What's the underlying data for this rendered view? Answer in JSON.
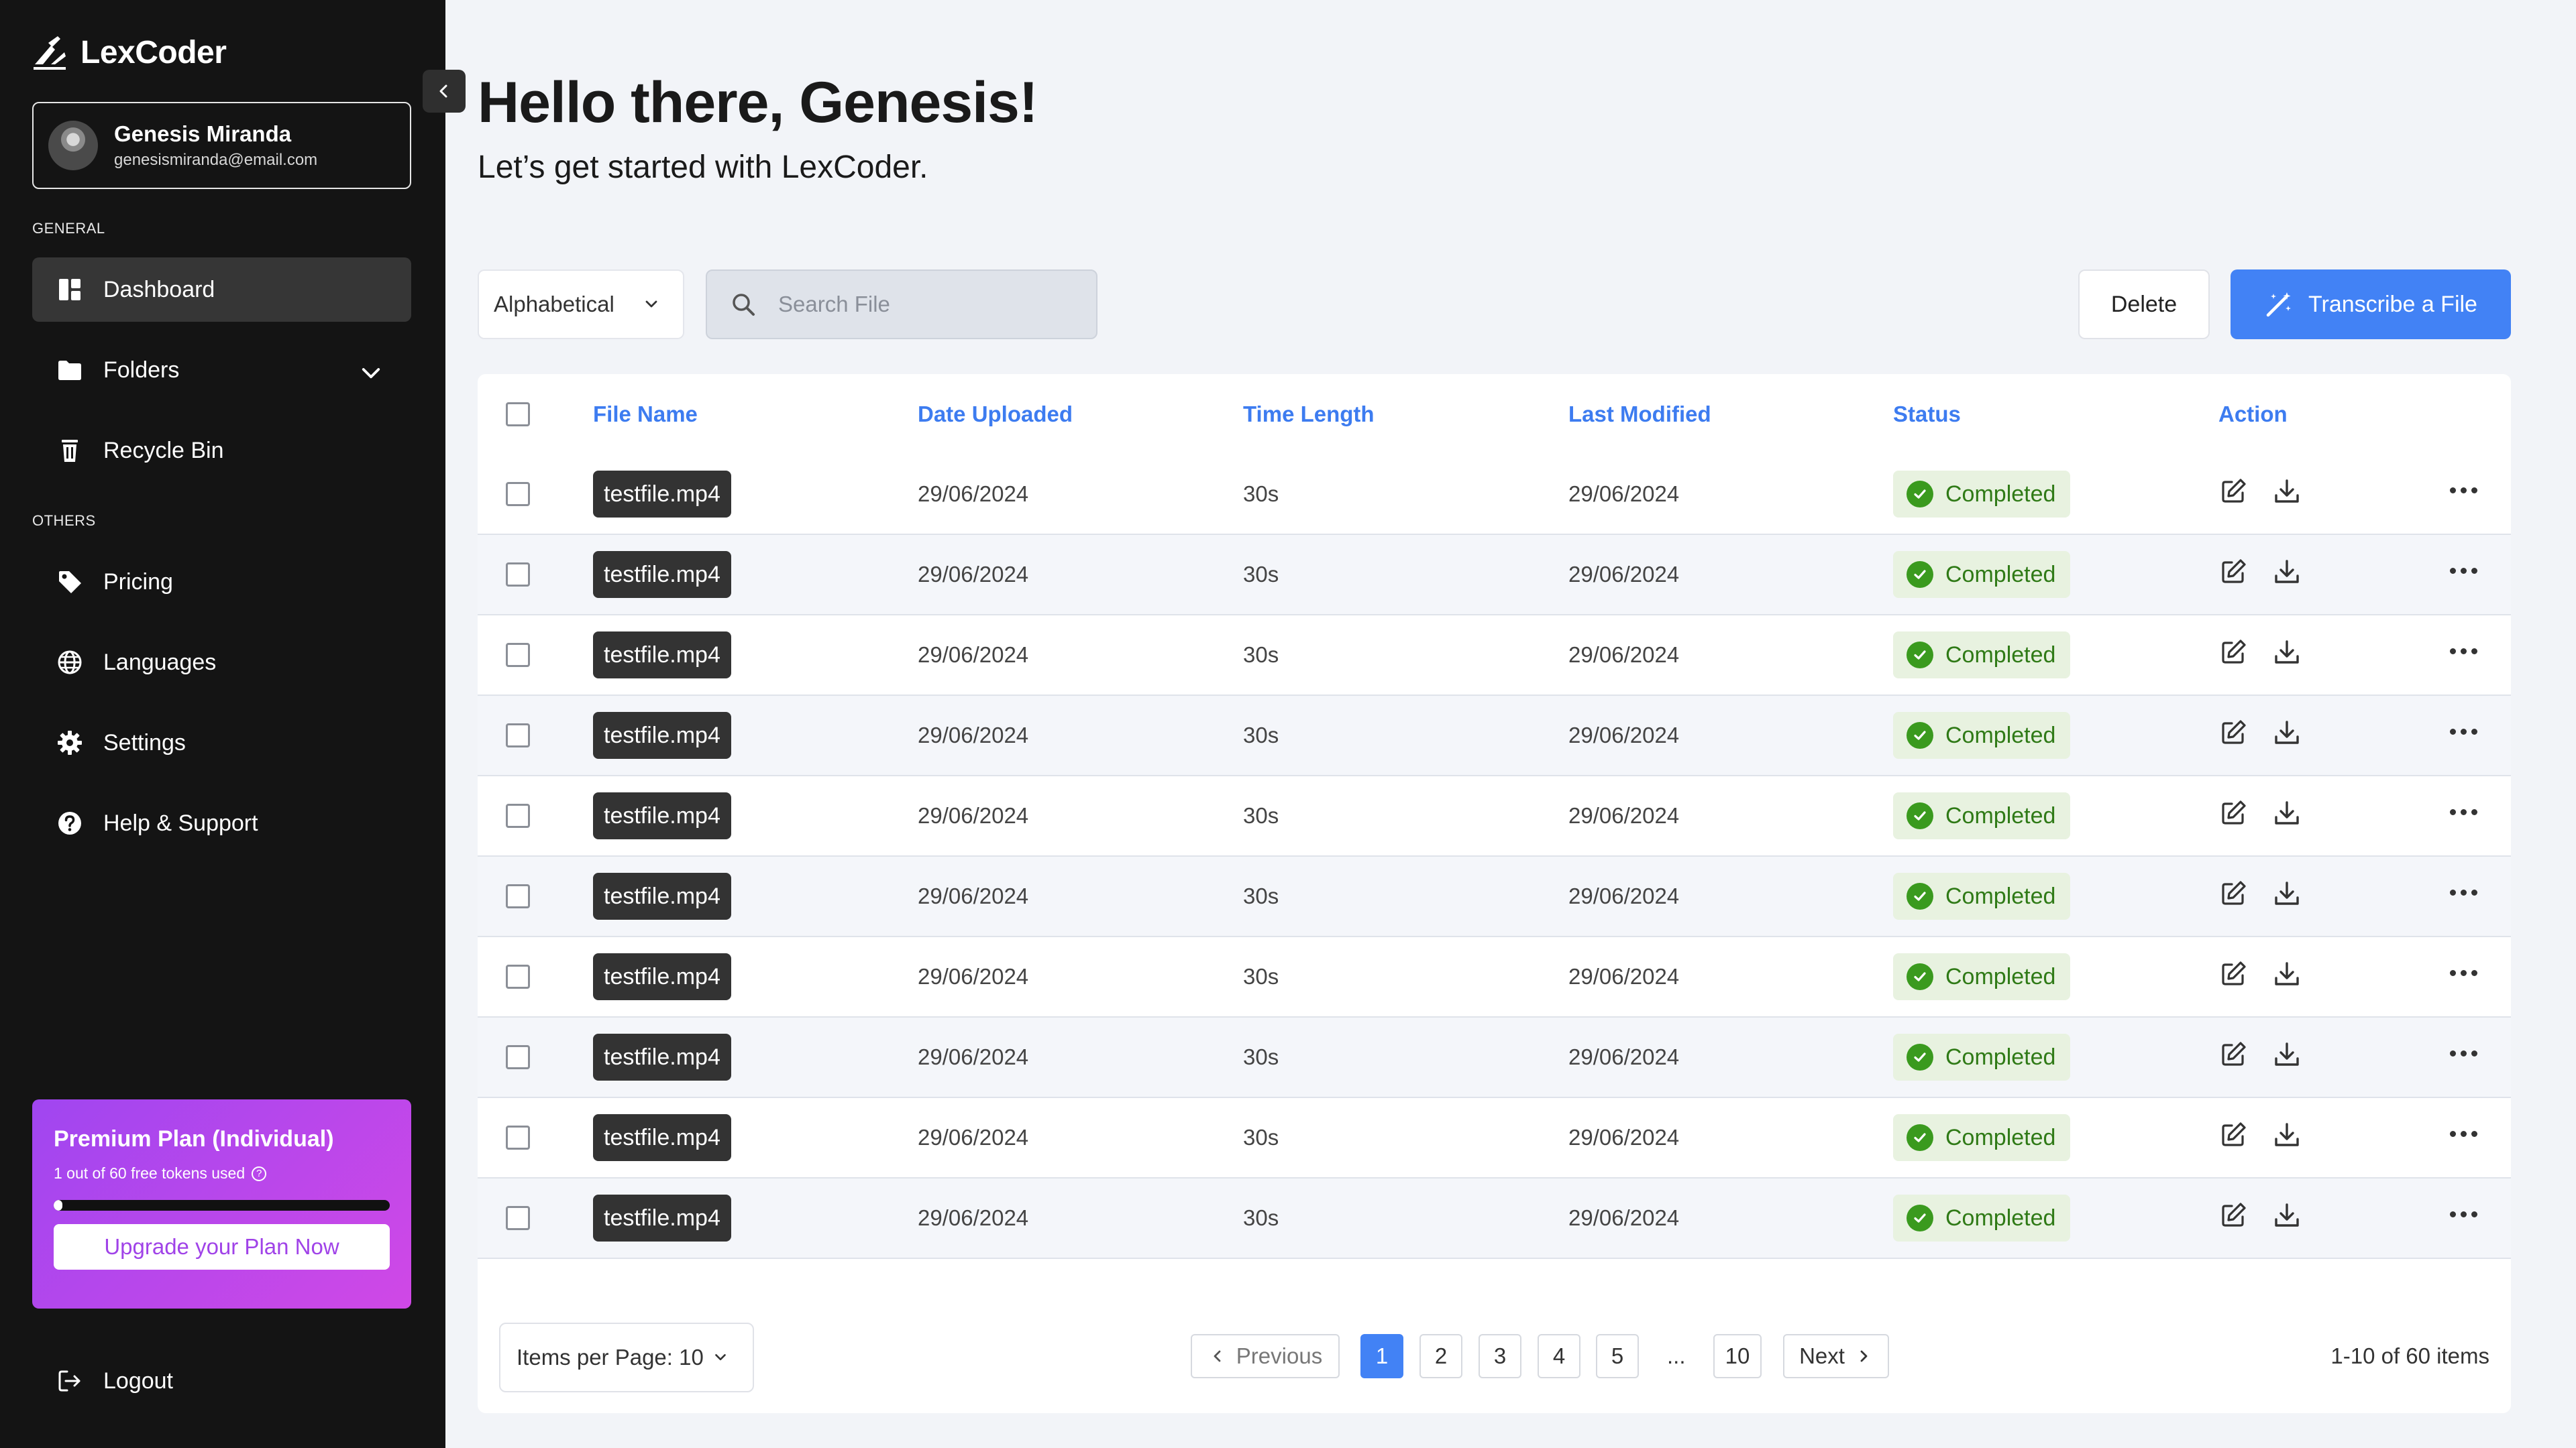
{
  "app": {
    "name": "LexCoder"
  },
  "user": {
    "name": "Genesis Miranda",
    "email": "genesismiranda@email.com"
  },
  "sidebar": {
    "general_label": "GENERAL",
    "others_label": "OTHERS",
    "general_items": [
      {
        "label": "Dashboard",
        "icon": "dashboard-icon",
        "active": true
      },
      {
        "label": "Folders",
        "icon": "folder-icon",
        "expandable": true
      },
      {
        "label": "Recycle Bin",
        "icon": "trash-icon"
      }
    ],
    "other_items": [
      {
        "label": "Pricing",
        "icon": "tag-icon"
      },
      {
        "label": "Languages",
        "icon": "globe-icon"
      },
      {
        "label": "Settings",
        "icon": "gear-icon"
      },
      {
        "label": "Help & Support",
        "icon": "help-icon"
      }
    ],
    "plan": {
      "title": "Premium Plan (Individual)",
      "usage": "1 out of 60 free tokens used",
      "usage_fraction": 0.0167,
      "upgrade_label": "Upgrade your Plan Now",
      "accent": "#a046f0"
    },
    "logout_label": "Logout"
  },
  "header": {
    "greeting": "Hello there, Genesis!",
    "subtitle": "Let’s get started with LexCoder."
  },
  "toolbar": {
    "sort_value": "Alphabetical",
    "search_placeholder": "Search File",
    "delete_label": "Delete",
    "transcribe_label": "Transcribe a File",
    "accent": "#4282f5"
  },
  "table": {
    "columns": [
      "File Name",
      "Date Uploaded",
      "Time Length",
      "Last Modified",
      "Status",
      "Action"
    ],
    "rows": [
      {
        "file": "testfile.mp4",
        "uploaded": "29/06/2024",
        "length": "30s",
        "modified": "29/06/2024",
        "status": "Completed"
      },
      {
        "file": "testfile.mp4",
        "uploaded": "29/06/2024",
        "length": "30s",
        "modified": "29/06/2024",
        "status": "Completed"
      },
      {
        "file": "testfile.mp4",
        "uploaded": "29/06/2024",
        "length": "30s",
        "modified": "29/06/2024",
        "status": "Completed"
      },
      {
        "file": "testfile.mp4",
        "uploaded": "29/06/2024",
        "length": "30s",
        "modified": "29/06/2024",
        "status": "Completed"
      },
      {
        "file": "testfile.mp4",
        "uploaded": "29/06/2024",
        "length": "30s",
        "modified": "29/06/2024",
        "status": "Completed"
      },
      {
        "file": "testfile.mp4",
        "uploaded": "29/06/2024",
        "length": "30s",
        "modified": "29/06/2024",
        "status": "Completed"
      },
      {
        "file": "testfile.mp4",
        "uploaded": "29/06/2024",
        "length": "30s",
        "modified": "29/06/2024",
        "status": "Completed"
      },
      {
        "file": "testfile.mp4",
        "uploaded": "29/06/2024",
        "length": "30s",
        "modified": "29/06/2024",
        "status": "Completed"
      },
      {
        "file": "testfile.mp4",
        "uploaded": "29/06/2024",
        "length": "30s",
        "modified": "29/06/2024",
        "status": "Completed"
      },
      {
        "file": "testfile.mp4",
        "uploaded": "29/06/2024",
        "length": "30s",
        "modified": "29/06/2024",
        "status": "Completed"
      }
    ],
    "status_color": "#3a9a1e"
  },
  "pagination": {
    "items_per_page": "Items per Page: 10",
    "previous_label": "Previous",
    "next_label": "Next",
    "pages": [
      "1",
      "2",
      "3",
      "4",
      "5"
    ],
    "ellipsis": "...",
    "last_page": "10",
    "current_page": "1",
    "range": "1-10 of 60 items"
  }
}
